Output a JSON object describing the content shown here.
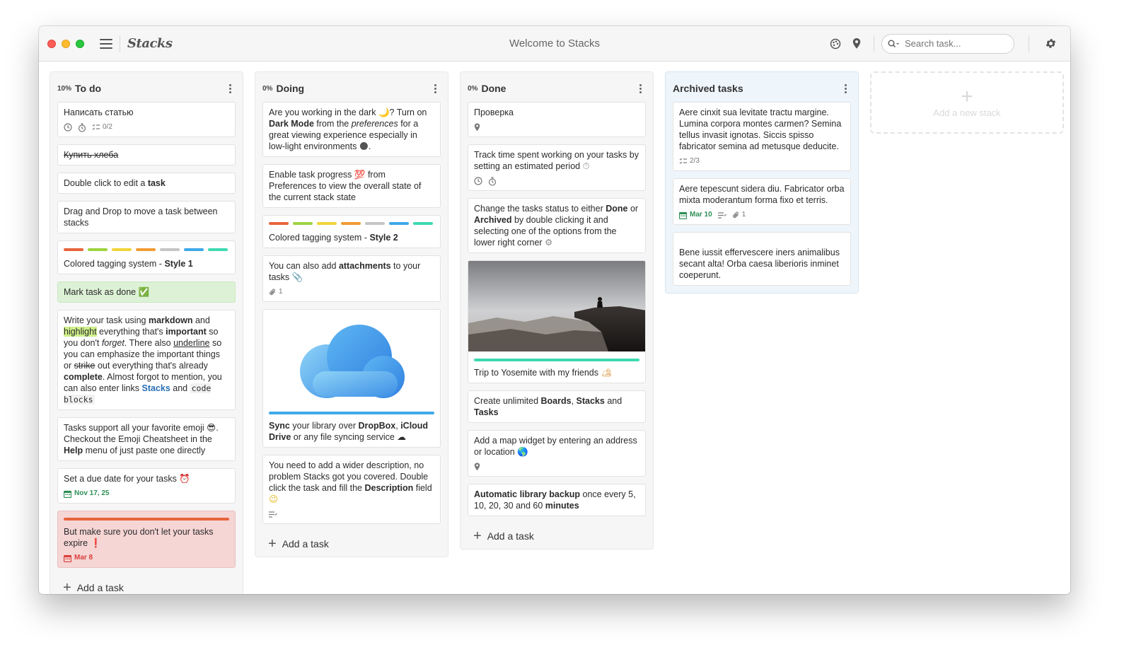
{
  "window": {
    "title": "Welcome to Stacks",
    "logo": "Stacks",
    "search_placeholder": "Search task..."
  },
  "icons": {
    "toolbar": [
      "menu-icon",
      "theme-icon",
      "location-pin-icon",
      "search-icon",
      "gear-icon"
    ],
    "card_meta": [
      "clock-icon",
      "stopwatch-icon",
      "subtasks-icon",
      "calendar-icon",
      "paperclip-icon",
      "description-icon",
      "location-pin-icon"
    ]
  },
  "colors": {
    "tag_red": "#e8643c",
    "tag_green": "#9dd33f",
    "tag_yellow": "#f1d43a",
    "tag_orange": "#f19b34",
    "tag_gray": "#c5c5c5",
    "tag_blue": "#3fa9e8",
    "tag_teal": "#3ed9b1",
    "due_green": "#2d8f55",
    "due_red": "#d9403b"
  },
  "stacks": {
    "todo": {
      "percent": "10%",
      "name": "To do",
      "add_label": "Add a task",
      "cards": {
        "c1": {
          "text": "Написать статью",
          "subtasks": "0/2"
        },
        "c2": {
          "text": "Купить хлеба"
        },
        "c3": {
          "text_a": "Double click to edit a ",
          "text_b": "task"
        },
        "c4": {
          "text": "Drag and Drop to move a task between stacks"
        },
        "c5": {
          "text_a": "Colored tagging system - ",
          "text_b": "Style 1"
        },
        "c6": {
          "text": "Mark task as done",
          "emoji": "✅"
        },
        "c7": {
          "p1": "Write your task using ",
          "b1": "markdown",
          "p2": " and ",
          "hl": "highlight",
          "p3": " everything that's ",
          "b2": "important",
          "p4": " so you don't ",
          "i1": "forget",
          "p5": ". There also ",
          "u1": "underline",
          "p6": " so you can emphasize the important things or ",
          "s1": "strike",
          "p7": " out everything that's already ",
          "b3": "complete",
          "p8": ". Almost forgot to mention, you can also enter links ",
          "link": "Stacks",
          "p9": " and ",
          "code": "code blocks"
        },
        "c8": {
          "p1": "Tasks support all your favorite emoji ",
          "emoji": "😎",
          "p2": ". Checkout the Emoji Cheatsheet in the ",
          "b1": "Help",
          "p3": " menu of just paste one directly"
        },
        "c9": {
          "text": "Set a due date for your tasks ",
          "emoji": "⏰",
          "due": "Nov 17, 25"
        },
        "c10": {
          "text": "But make sure you don't let your tasks expire ",
          "emoji": "❗",
          "due": "Mar 8"
        }
      }
    },
    "doing": {
      "percent": "0%",
      "name": "Doing",
      "add_label": "Add a task",
      "cards": {
        "c1": {
          "p1": "Are you working in the dark ",
          "e1": "🌙",
          "p2": "? Turn on ",
          "b1": "Dark Mode",
          "p3": " from the ",
          "i1": "preferences",
          "p4": " for a great viewing experience especially in low-light environments ",
          "e2": "🌑",
          "p5": "."
        },
        "c2": {
          "p1": "Enable task progress ",
          "e1": "💯",
          "p2": " from Preferences to view the overall state of the current stack state"
        },
        "c3": {
          "text_a": "Colored tagging system - ",
          "text_b": "Style 2"
        },
        "c4": {
          "p1": "You can also add ",
          "b1": "attachments",
          "p2": " to your tasks ",
          "e1": "📎",
          "attachments": "1"
        },
        "c5": {
          "b1": "Sync",
          "p1": " your library over ",
          "b2": "DropBox",
          "p2": ", ",
          "b3": "iCloud Drive",
          "p3": " or any file syncing service ",
          "e1": "☁"
        },
        "c6": {
          "p1": "You need to add a wider description, no problem Stacks got you covered. Double click the task and fill the ",
          "b1": "Description",
          "p2": " field ",
          "e1": "😉"
        }
      }
    },
    "done": {
      "percent": "0%",
      "name": "Done",
      "add_label": "Add a task",
      "cards": {
        "c1": {
          "text": "Проверка"
        },
        "c2": {
          "p1": "Track time spent working on your tasks by setting an estimated period ",
          "e1": "⏱"
        },
        "c3": {
          "p1": "Change the tasks status to either ",
          "b1": "Done",
          "p2": " or ",
          "b2": "Archived",
          "p3": " by double clicking it and selecting one of the options from the lower right corner ",
          "e1": "⚙"
        },
        "c4": {
          "text": "Trip to Yosemite with my friends ",
          "e1": "🏕"
        },
        "c5": {
          "p1": "Create unlimited ",
          "b1": "Boards",
          "p2": ", ",
          "b2": "Stacks",
          "p3": " and ",
          "b3": "Tasks"
        },
        "c6": {
          "p1": "Add a map widget by entering an address or location ",
          "e1": "🌎"
        },
        "c7": {
          "b1": "Automatic library backup",
          "p1": " once every 5, 10, 20, 30 and 60 ",
          "b2": "minutes"
        }
      }
    },
    "archived": {
      "name": "Archived tasks",
      "cards": {
        "c1": {
          "text": "Aere cinxit sua levitate tractu margine. Lumina corpora montes carmen? Semina tellus invasit ignotas. Siccis spisso fabricator semina ad metusque deducite.",
          "subtasks": "2/3"
        },
        "c2": {
          "text": "Aere tepescunt sidera diu. Fabricator orba mixta moderantum forma fixo et terris.",
          "due": "Mar 10",
          "attachments": "1"
        },
        "c3": {
          "text": "Bene iussit effervescere iners animalibus secant alta! Orba caesa liberioris inminet coeperunt."
        }
      }
    }
  },
  "add_stack_label": "Add a new stack"
}
